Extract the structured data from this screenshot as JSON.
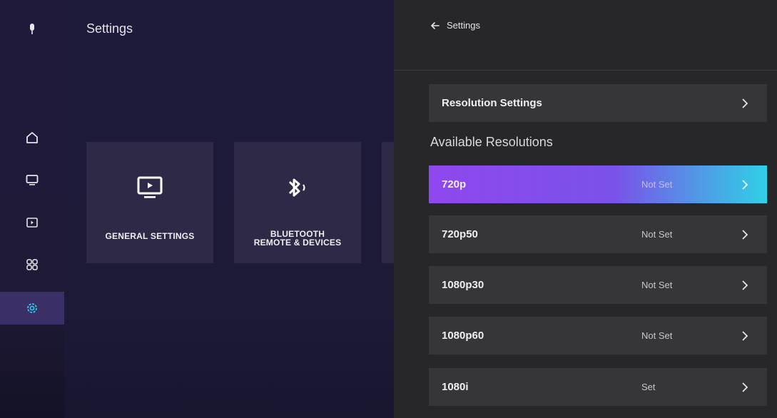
{
  "nav": {
    "items": [
      {
        "name": "mic",
        "icon": "microphone-icon"
      },
      {
        "name": "home",
        "icon": "home-icon"
      },
      {
        "name": "tv",
        "icon": "tv-icon"
      },
      {
        "name": "media",
        "icon": "media-player-icon"
      },
      {
        "name": "apps",
        "icon": "apps-grid-icon"
      },
      {
        "name": "settings",
        "icon": "gear-icon",
        "active": true
      }
    ],
    "active_color": "#3a2f66",
    "active_icon_color": "#2fd0e6"
  },
  "main": {
    "title": "Settings",
    "tiles": [
      {
        "label_lines": [
          "GENERAL SETTINGS"
        ],
        "icon": "tv-play-icon"
      },
      {
        "label_lines": [
          "BLUETOOTH",
          "REMOTE & DEVICES"
        ],
        "icon": "bluetooth-icon"
      }
    ]
  },
  "panel": {
    "back_label": "Settings",
    "top_item": "Resolution Settings",
    "section_title": "Available Resolutions",
    "resolutions": [
      {
        "label": "720p",
        "status": "Not Set",
        "selected": true
      },
      {
        "label": "720p50",
        "status": "Not Set",
        "selected": false
      },
      {
        "label": "1080p30",
        "status": "Not Set",
        "selected": false
      },
      {
        "label": "1080p60",
        "status": "Not Set",
        "selected": false
      },
      {
        "label": "1080i",
        "status": "Set",
        "selected": false
      }
    ],
    "accent_gradient": [
      "#8f47ee",
      "#2fd0e6"
    ]
  }
}
